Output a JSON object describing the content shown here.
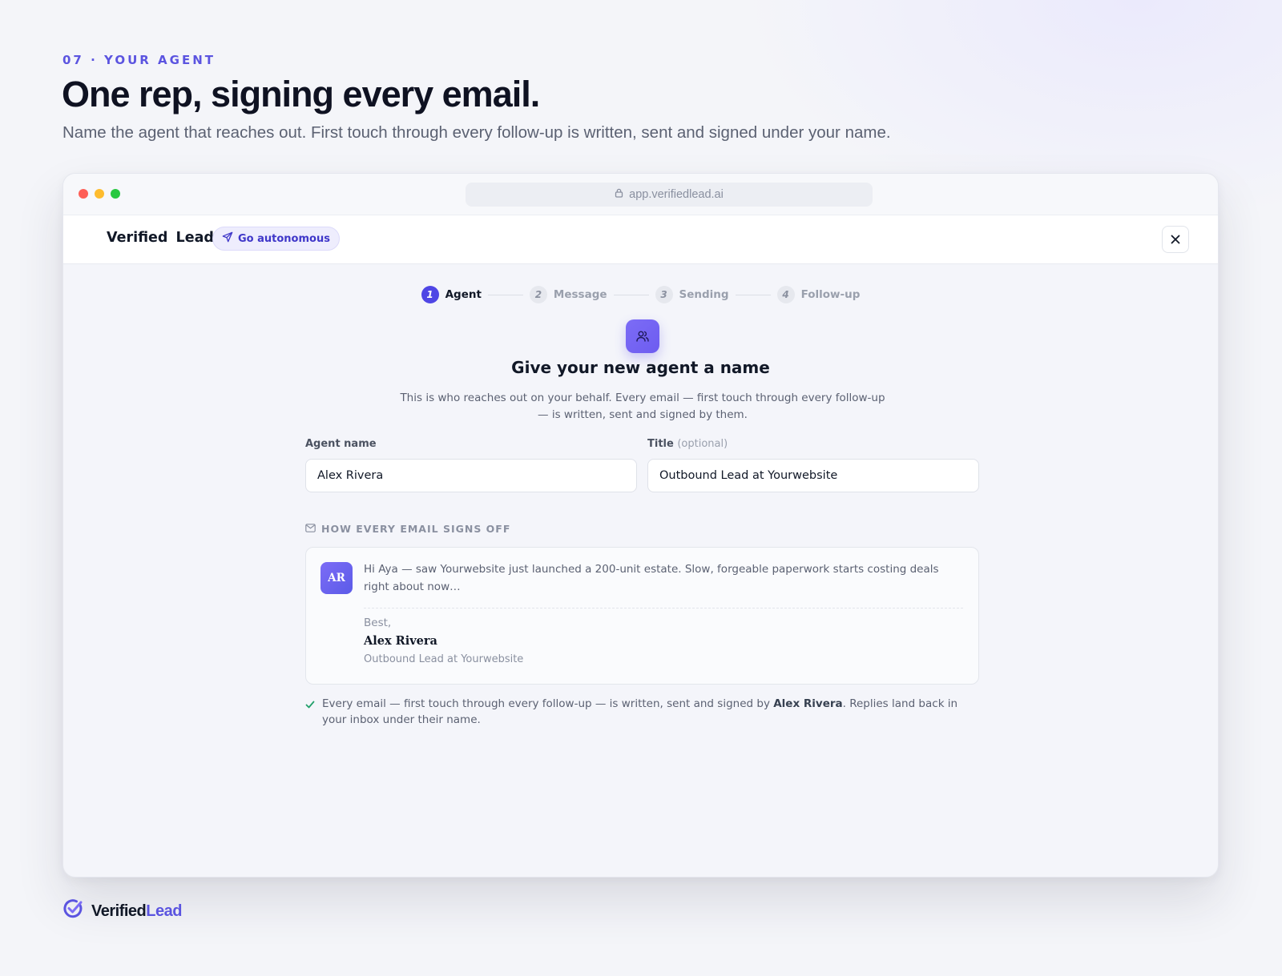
{
  "header": {
    "eyebrow": "07 · YOUR AGENT",
    "title": "One rep, signing every email.",
    "subtitle": "Name the agent that reaches out. First touch through every follow-up is written, sent and signed under your name."
  },
  "browser": {
    "url": "app.verifiedlead.ai"
  },
  "appbar": {
    "brand": "Verified Lead",
    "mode_pill": "Go autonomous"
  },
  "stepper": {
    "steps": [
      {
        "num": "1",
        "label": "Agent",
        "active": true
      },
      {
        "num": "2",
        "label": "Message",
        "active": false
      },
      {
        "num": "3",
        "label": "Sending",
        "active": false
      },
      {
        "num": "4",
        "label": "Follow-up",
        "active": false
      }
    ]
  },
  "form": {
    "title": "Give your new agent a name",
    "description": "This is who reaches out on your behalf. Every email — first touch through every follow-up — is written, sent and signed by them.",
    "agent_name_label": "Agent name",
    "agent_name_value": "Alex Rivera",
    "title_label": "Title",
    "title_optional": "(optional)",
    "title_value": "Outbound Lead at Yourwebsite"
  },
  "preview": {
    "section_label": "HOW EVERY EMAIL SIGNS OFF",
    "avatar_initials": "AR",
    "body": "Hi Aya — saw Yourwebsite just launched a 200-unit estate. Slow, forgeable paperwork starts costing deals right about now…",
    "signoff": "Best,",
    "signature_name": "Alex Rivera",
    "signature_title": "Outbound Lead at Yourwebsite"
  },
  "confirmation": {
    "before": "Every email — first touch through every follow-up — is written, sent and signed by ",
    "name": "Alex Rivera",
    "after": ". Replies land back in your inbox under their name."
  },
  "footer": {
    "logo_part1": "Verified",
    "logo_part2": "Lead"
  },
  "colors": {
    "accent": "#4f46e5",
    "accent_light": "#7c6cf6",
    "check": "#22a06b"
  },
  "icons": [
    "lock-icon",
    "send-icon",
    "close-icon",
    "users-icon",
    "mail-icon",
    "check-icon",
    "logo-check-icon"
  ]
}
